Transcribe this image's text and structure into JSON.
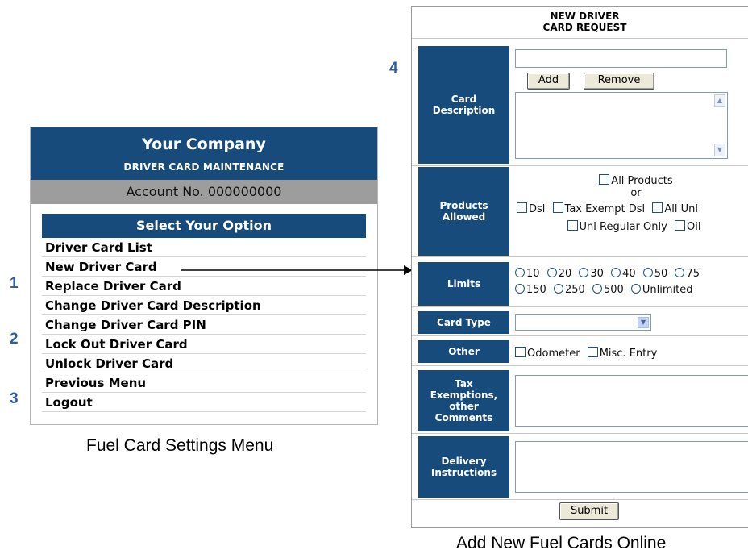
{
  "menu": {
    "company_name": "Your Company",
    "subtitle": "DRIVER CARD MAINTENANCE",
    "account": "Account No. 000000000",
    "select_header": "Select Your Option",
    "items": [
      "Driver Card List",
      "New Driver Card",
      "Replace Driver Card",
      "Change Driver Card Description",
      "Change Driver Card PIN",
      "Lock Out Driver Card",
      "Unlock Driver Card",
      "Previous Menu",
      "Logout"
    ],
    "caption": "Fuel Card Settings Menu"
  },
  "steps": [
    "1",
    "2",
    "3",
    "4"
  ],
  "form": {
    "title_line1": "NEW DRIVER",
    "title_line2": "CARD REQUEST",
    "card_description": {
      "label_line1": "Card",
      "label_line2": "Description",
      "input_value": "",
      "add_label": "Add",
      "remove_label": "Remove"
    },
    "products": {
      "label_line1": "Products",
      "label_line2": "Allowed",
      "all_products": "All Products",
      "or": "or",
      "dsl": "Dsl",
      "tax_exempt_dsl": "Tax Exempt Dsl",
      "all_unl": "All Unl",
      "unl_regular_only": "Unl Regular Only",
      "oil": "Oil"
    },
    "limits": {
      "label": "Limits",
      "options_row1": [
        "10",
        "20",
        "30",
        "40",
        "50",
        "75"
      ],
      "options_row2": [
        "150",
        "250",
        "500",
        "Unlimited"
      ]
    },
    "card_type": {
      "label": "Card Type",
      "selected": ""
    },
    "other": {
      "label": "Other",
      "odometer": "Odometer",
      "misc_entry": "Misc. Entry"
    },
    "tax": {
      "label_line1": "Tax",
      "label_line2": "Exemptions,",
      "label_line3": "other",
      "label_line4": "Comments",
      "value": ""
    },
    "delivery": {
      "label_line1": "Delivery",
      "label_line2": "Instructions",
      "value": ""
    },
    "submit_label": "Submit",
    "caption": "Add New Fuel Cards Online"
  },
  "colors": {
    "header_blue": "#164b7b",
    "step_blue": "#2d5e9f",
    "account_gray": "#9d9d9d"
  }
}
